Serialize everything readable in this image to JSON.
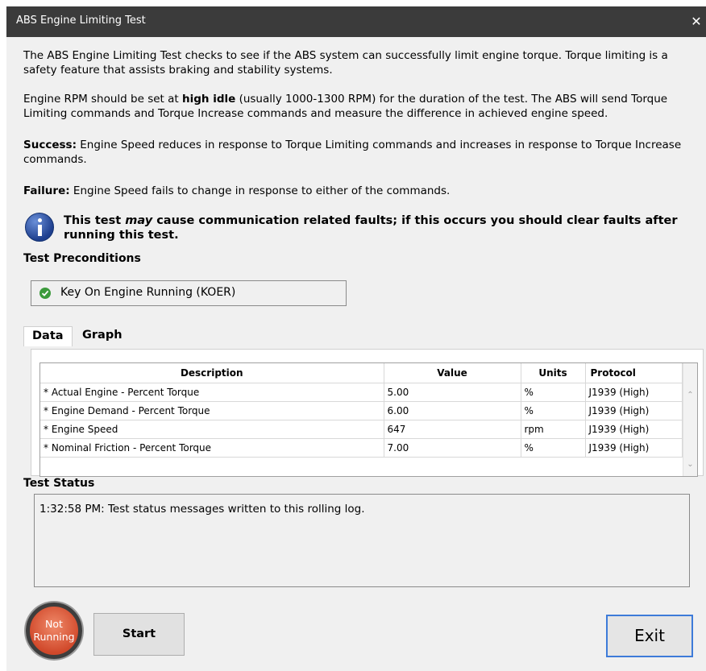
{
  "window": {
    "title": "ABS Engine Limiting Test",
    "close_glyph": "✕"
  },
  "description": {
    "p1": "The ABS Engine Limiting Test checks to see if the ABS system can successfully limit engine torque. Torque limiting is a safety feature that assists braking and stability systems.",
    "p2_pre": "Engine RPM should be set at ",
    "p2_bold": "high idle",
    "p2_post": " (usually 1000-1300 RPM) for the duration of the test. The ABS will send Torque Limiting commands and Torque Increase commands and measure the difference in achieved engine speed.",
    "success_label": "Success:",
    "success_text": " Engine Speed reduces in response to Torque Limiting commands and increases in response to Torque Increase commands.",
    "failure_label": "Failure:",
    "failure_text": " Engine Speed fails to change in response to either of the commands."
  },
  "info": {
    "icon": "info-icon",
    "pre": "This test ",
    "emph": "may",
    "post": " cause communication related faults; if this occurs you should clear faults after running this test."
  },
  "preconditions": {
    "heading": "Test Preconditions",
    "item": {
      "icon": "check-icon",
      "label": "Key On Engine Running (KOER)",
      "status_color": "#3c9a3c"
    }
  },
  "tabs": [
    {
      "label": "Data",
      "active": true
    },
    {
      "label": "Graph",
      "active": false
    }
  ],
  "table": {
    "columns": [
      "Description",
      "Value",
      "Units",
      "Protocol"
    ],
    "rows": [
      [
        "* Actual Engine - Percent Torque",
        "5.00",
        "%",
        "J1939 (High)"
      ],
      [
        "* Engine Demand - Percent Torque",
        "6.00",
        "%",
        "J1939 (High)"
      ],
      [
        "* Engine Speed",
        "647",
        "rpm",
        "J1939 (High)"
      ],
      [
        "* Nominal Friction - Percent Torque",
        "7.00",
        "%",
        "J1939 (High)"
      ]
    ]
  },
  "status": {
    "heading": "Test Status",
    "log": "1:32:58 PM: Test status messages written to this rolling log."
  },
  "indicator": {
    "line1": "Not",
    "line2": "Running",
    "color": "#d0482a"
  },
  "buttons": {
    "start": "Start",
    "exit": "Exit"
  }
}
